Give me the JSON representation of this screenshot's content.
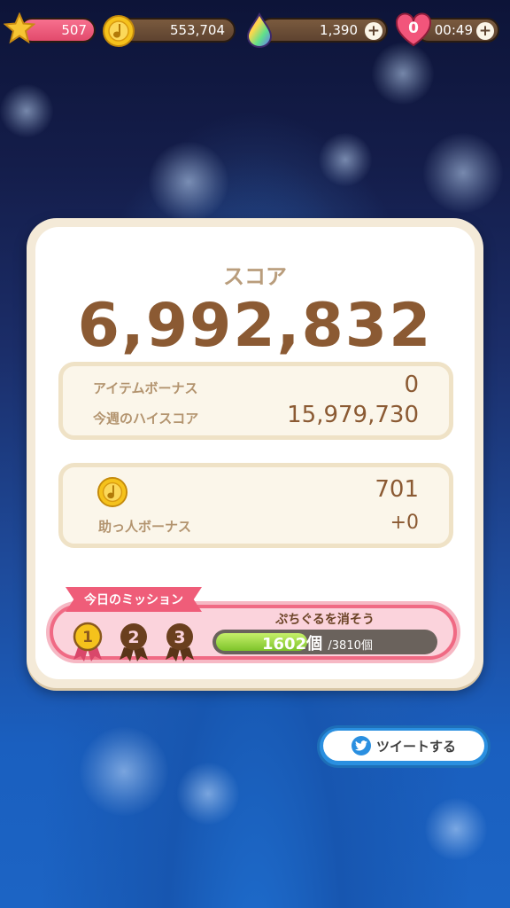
{
  "hud": {
    "level": "507",
    "coins": "553,704",
    "gems": "1,390",
    "lives": "0",
    "life_timer": "00:49",
    "plus_symbol": "+"
  },
  "result": {
    "score_label": "スコア",
    "score": "6,992,832",
    "item_bonus_label": "アイテムボーナス",
    "item_bonus_value": "0",
    "weekly_high_label": "今週のハイスコア",
    "weekly_high_value": "15,979,730",
    "coins_earned": "701",
    "helper_bonus_label": "助っ人ボーナス",
    "helper_bonus_value": "+0"
  },
  "mission": {
    "ribbon_label": "今日のミッション",
    "title": "ぷちぐるを消そう",
    "current": "1602個",
    "total": "/3810個",
    "progress_fraction": 0.42,
    "medals": [
      "1",
      "2",
      "3"
    ]
  },
  "tweet": {
    "label": "ツイートする"
  },
  "colors": {
    "score_brown": "#8b5a33",
    "label_tan": "#b3946f",
    "mission_pink": "#f06a84",
    "progress_green": "#7dc32a",
    "twitter_blue": "#2a8fe0"
  }
}
